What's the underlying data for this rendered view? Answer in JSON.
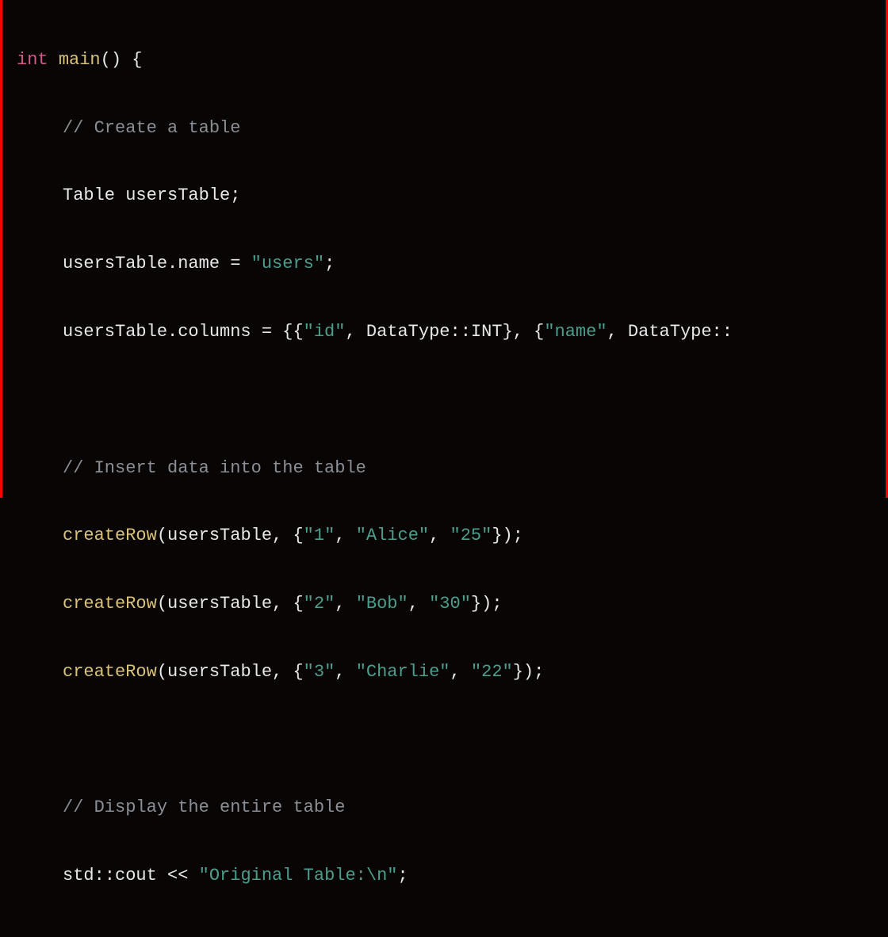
{
  "code": {
    "line1": {
      "kw_int": "int",
      "fn_main": "main",
      "parens_brace": "() {"
    },
    "line2": {
      "comment": "// Create a table"
    },
    "line3": {
      "decl": "Table usersTable;"
    },
    "line4": {
      "lhs": "usersTable.name = ",
      "str": "\"users\"",
      "tail": ";"
    },
    "line5": {
      "lhs": "usersTable.columns = {{",
      "s1": "\"id\"",
      "mid1": ", DataType::INT}, {",
      "s2": "\"name\"",
      "tail": ", DataType::"
    },
    "line6_blank": " ",
    "line7": {
      "comment": "// Insert data into the table"
    },
    "line8": {
      "fn": "createRow",
      "open": "(usersTable, {",
      "s1": "\"1\"",
      "c1": ", ",
      "s2": "\"Alice\"",
      "c2": ", ",
      "s3": "\"25\"",
      "close": "});"
    },
    "line9": {
      "fn": "createRow",
      "open": "(usersTable, {",
      "s1": "\"2\"",
      "c1": ", ",
      "s2": "\"Bob\"",
      "c2": ", ",
      "s3": "\"30\"",
      "close": "});"
    },
    "line10": {
      "fn": "createRow",
      "open": "(usersTable, {",
      "s1": "\"3\"",
      "c1": ", ",
      "s2": "\"Charlie\"",
      "c2": ", ",
      "s3": "\"22\"",
      "close": "});"
    },
    "line11_blank": " ",
    "line12": {
      "comment": "// Display the entire table"
    },
    "line13": {
      "lhs": "std::cout << ",
      "str": "\"Original Table:\\n\"",
      "tail": ";"
    }
  }
}
